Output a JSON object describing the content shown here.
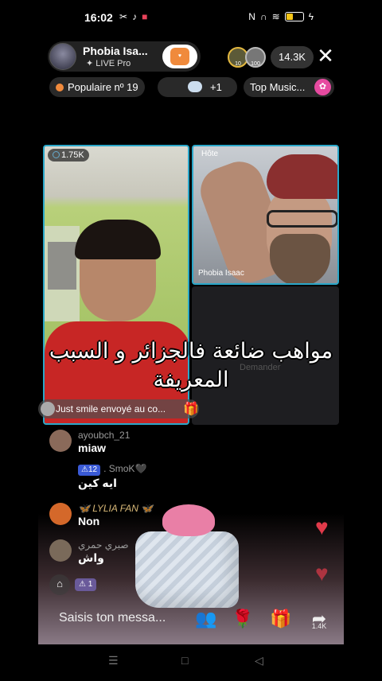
{
  "status": {
    "time": "16:02",
    "left_icons": [
      "scissors-icon",
      "tiktok-icon",
      "record-icon"
    ],
    "right_icons": [
      "nfc-icon",
      "headset-icon",
      "wifi-icon",
      "battery-icon",
      "charging-icon"
    ],
    "battery_level": 0.45
  },
  "header": {
    "host_name": "Phobia Isa...",
    "host_subtitle": "LIVE Pro",
    "follow_icon": "heart-badge-icon",
    "viewer_badges": [
      "10",
      "100"
    ],
    "viewer_count": "14.3K",
    "close_label": "✕"
  },
  "chips": {
    "popular_label": "Populaire nº 19",
    "plus_label": "+1",
    "music_label": "Top Music..."
  },
  "video": {
    "guest_coin_count": "1.75K",
    "host_tag": "Hôte",
    "host_tile_name": "Phobia Isaac",
    "empty_tile_text": "Demander"
  },
  "caption": {
    "line1": "مواهب ضائعة فالجزائر و السبب",
    "line2": "المعريفة"
  },
  "gift_notice": {
    "text": "Just smile envoyé au co..."
  },
  "chat": [
    {
      "user": "ayoubch_21",
      "message": "miaw",
      "badge": ""
    },
    {
      "user": ". SmoK🖤",
      "message": "ايه كين",
      "badge": "12"
    },
    {
      "user": "🦋 LYLIA FAN 🦋",
      "message": "Non",
      "badge": ""
    },
    {
      "user": "صبري حمري",
      "message": "واش",
      "badge": ""
    }
  ],
  "bottom": {
    "mini_badge": "1",
    "input_placeholder": "Saisis ton messa...",
    "share_count": "1.4K"
  },
  "colors": {
    "tile_border": "#2aa7c9",
    "heart": "#e03a4a",
    "gift_pink": "#e97fa6"
  }
}
